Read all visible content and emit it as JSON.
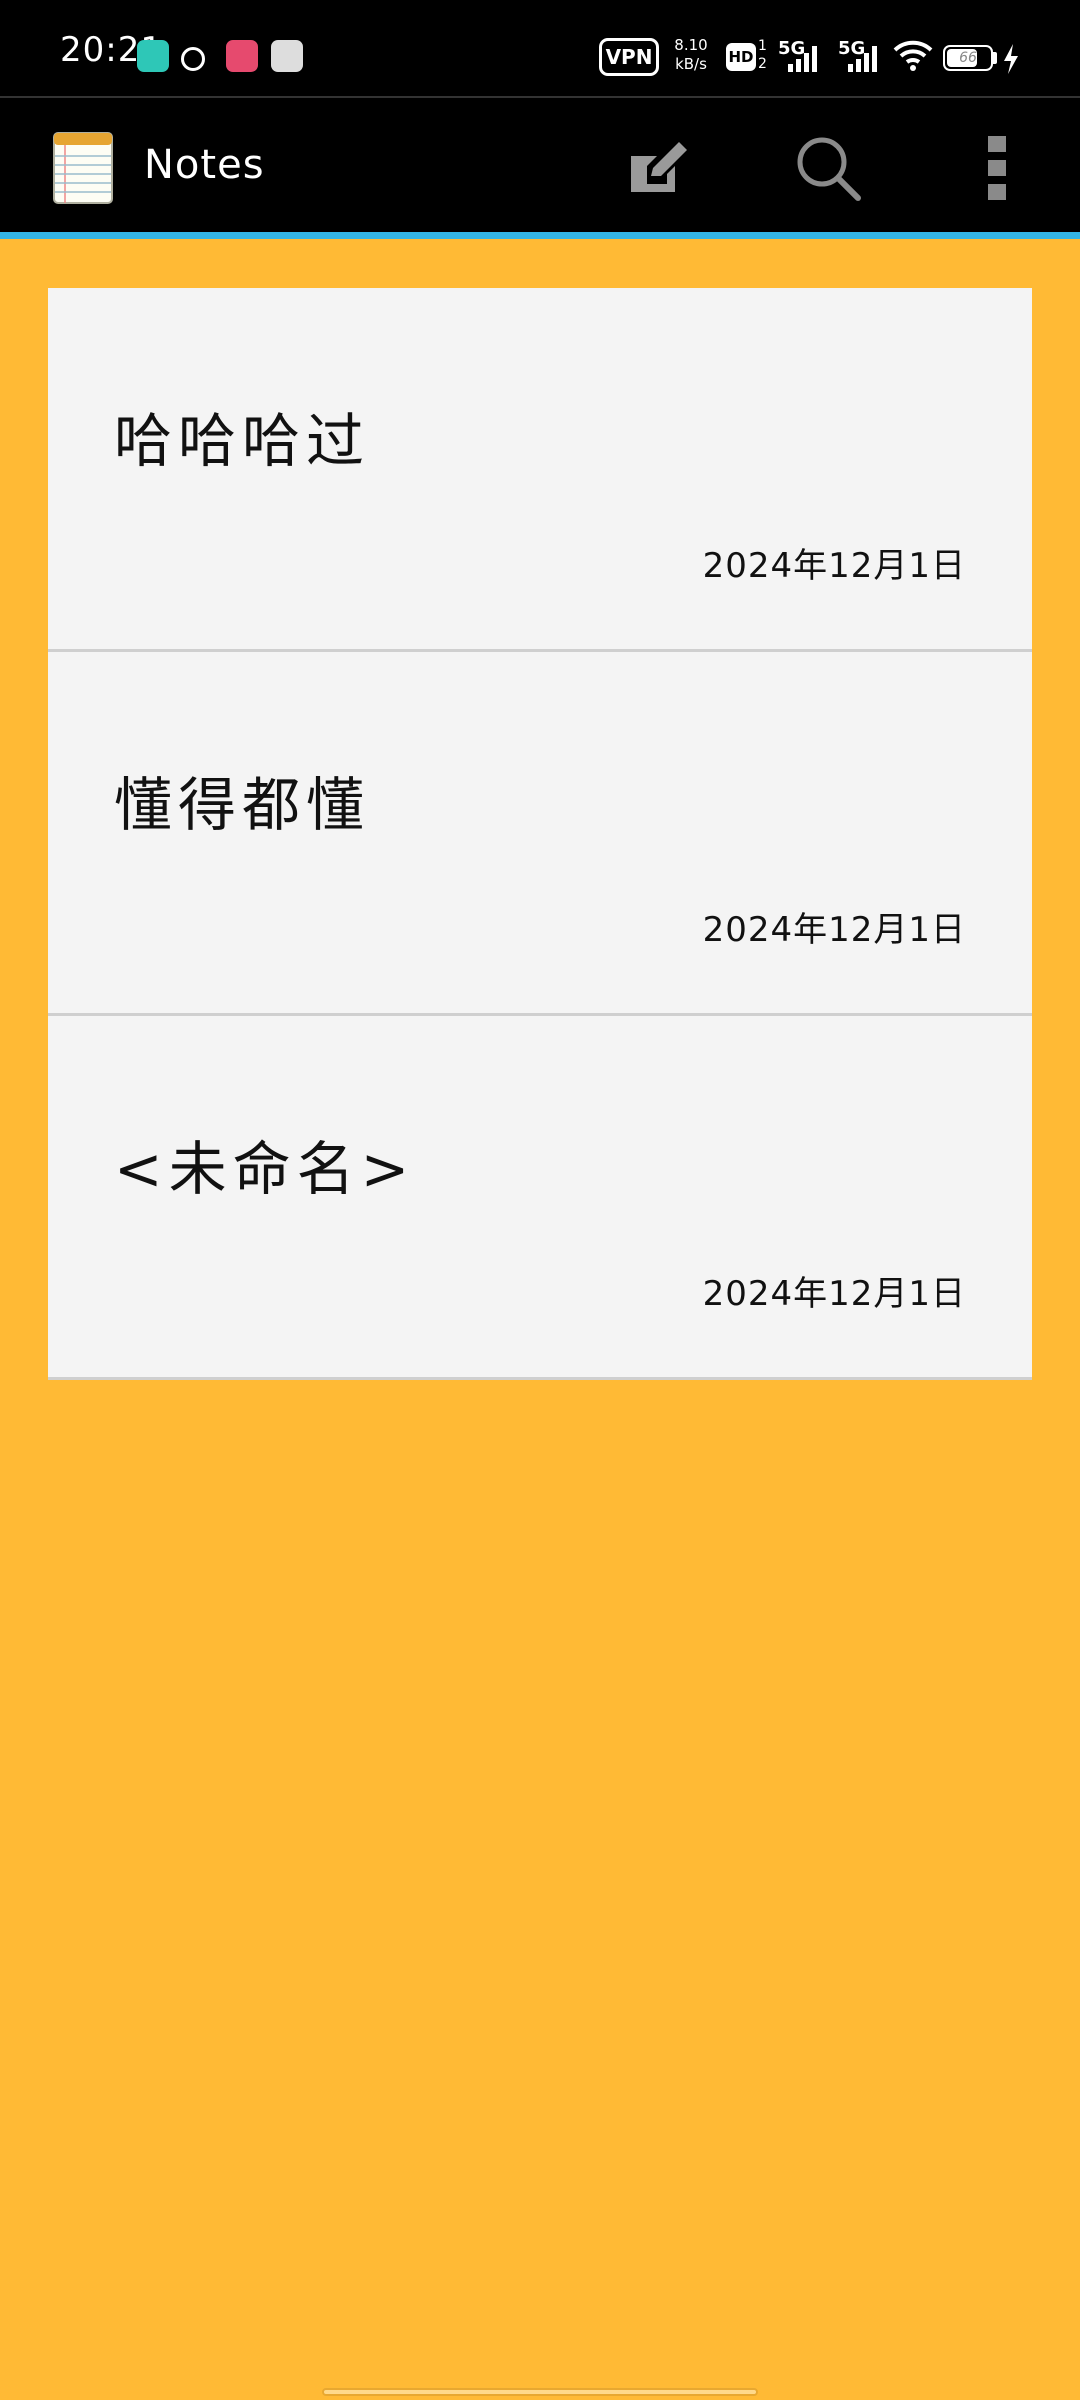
{
  "status_bar": {
    "time": "20:21",
    "vpn": "VPN",
    "net_speed_value": "8.10",
    "net_speed_unit": "kB/s",
    "hd": "HD",
    "sim_top": "1",
    "sim_bottom": "2",
    "network_1": "5G",
    "network_2": "5G",
    "battery": "66",
    "notification_icons": [
      "green-app-icon",
      "link-app-icon",
      "bilibili-app-icon",
      "running-app-icon"
    ]
  },
  "action_bar": {
    "title": "Notes",
    "icons": [
      "notepad-icon",
      "new-note-icon",
      "search-icon",
      "overflow-menu-icon"
    ],
    "accent_color": "#33B5E5"
  },
  "notes": [
    {
      "title": "哈哈哈过",
      "date": "2024年12月1日"
    },
    {
      "title": "懂得都懂",
      "date": "2024年12月1日"
    },
    {
      "title": "<未命名>",
      "date": "2024年12月1日"
    }
  ],
  "colors": {
    "background": "#FFBA35",
    "card": "#F4F4F4",
    "action_bar": "#000000"
  }
}
